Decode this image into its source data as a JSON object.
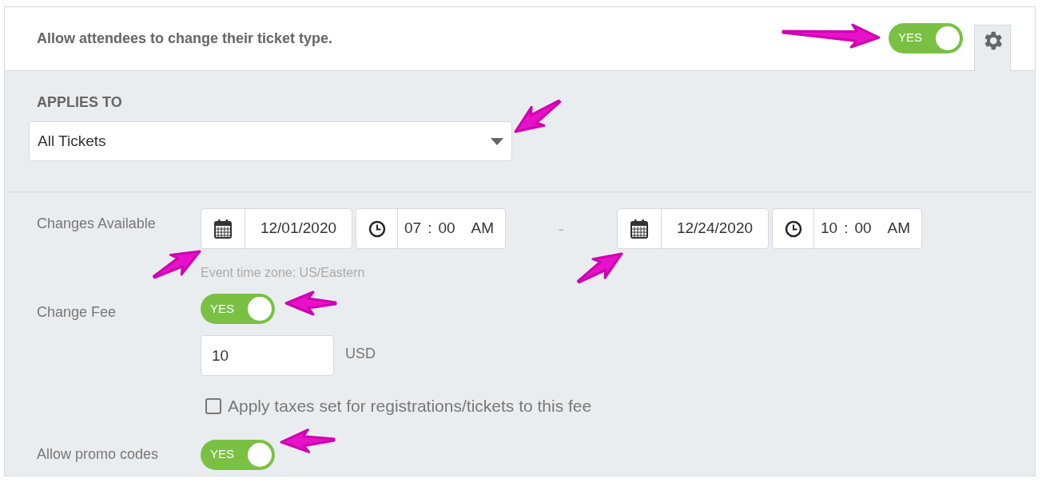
{
  "header": {
    "title": "Allow attendees to change their ticket type.",
    "toggle": {
      "label": "YES",
      "on": true
    }
  },
  "applies_to": {
    "label": "APPLIES TO",
    "select": {
      "value": "All Tickets"
    }
  },
  "changes_available": {
    "label": "Changes Available",
    "start": {
      "date": "12/01/2020",
      "hour": "07",
      "separator": ":",
      "minute": "00",
      "period": "AM"
    },
    "dash": "-",
    "end": {
      "date": "12/24/2020",
      "hour": "10",
      "separator": ":",
      "minute": "00",
      "period": "AM"
    },
    "timezone_note": "Event time zone: US/Eastern"
  },
  "change_fee": {
    "label": "Change Fee",
    "toggle": {
      "label": "YES",
      "on": true
    },
    "amount": "10",
    "currency": "USD",
    "taxes_checkbox": {
      "label": "Apply taxes set for registrations/tickets to this fee",
      "checked": false
    }
  },
  "promo_codes": {
    "label": "Allow promo codes",
    "toggle": {
      "label": "YES",
      "on": true
    }
  }
}
